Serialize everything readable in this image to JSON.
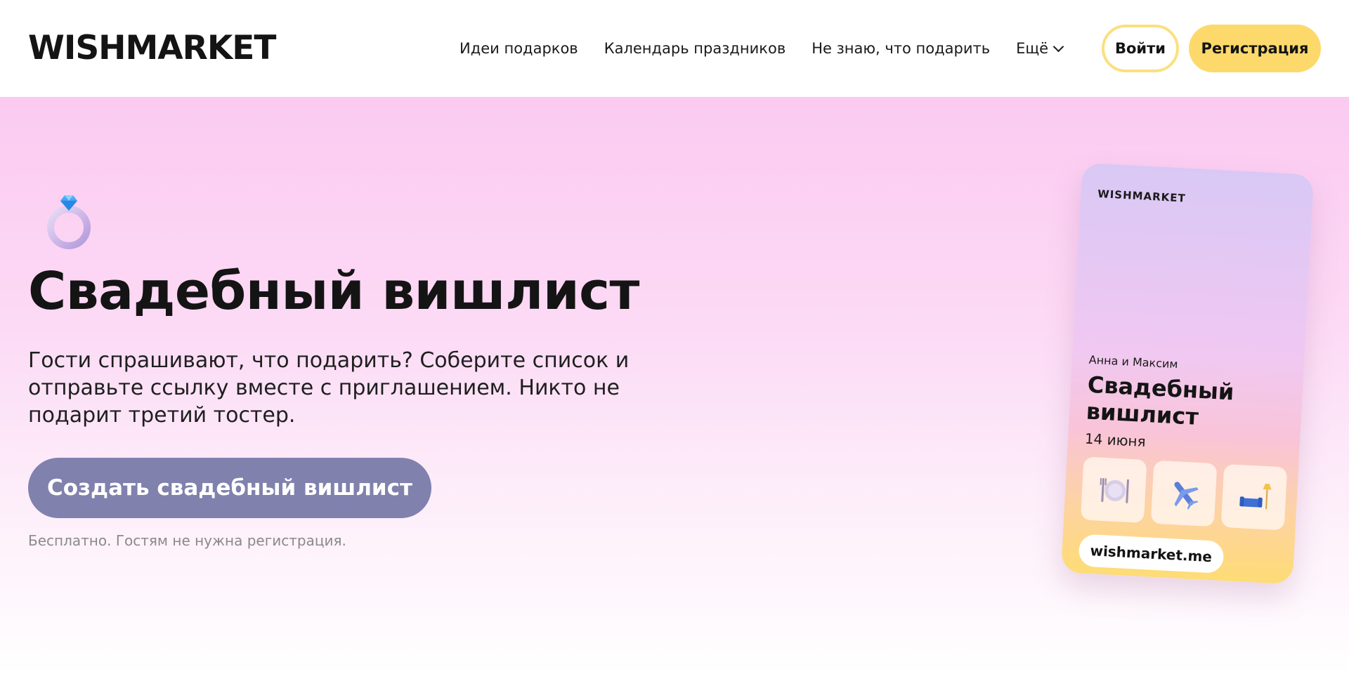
{
  "header": {
    "logo": "WISHMARKET",
    "nav": [
      {
        "label": "Идеи подарков"
      },
      {
        "label": "Календарь праздников"
      },
      {
        "label": "Не знаю, что подарить"
      },
      {
        "label": "Ещё"
      }
    ],
    "login_label": "Войти",
    "register_label": "Регистрация"
  },
  "hero": {
    "icon": "ring-icon",
    "title": "Свадебный вишлист",
    "subtitle_lines": [
      "Гости спрашивают, что подарить? Соберите список и",
      "отправьте ссылку вместе с приглашением. Никто не",
      "подарит третий тостер."
    ],
    "cta_label": "Создать свадебный вишлист",
    "note": "Бесплатно. Гостям не нужна регистрация."
  },
  "card": {
    "logo": "WISHMARKET",
    "names": "Анна и Максим",
    "title_lines": [
      "Свадебный",
      "вишлист"
    ],
    "date": "14 июня",
    "tiles": [
      {
        "icon": "plate-cutlery-icon"
      },
      {
        "icon": "airplane-icon"
      },
      {
        "icon": "sofa-lamp-icon"
      }
    ],
    "url": "wishmarket.me"
  },
  "colors": {
    "accent_yellow": "#fdd96b",
    "cta_purple": "#8081ad",
    "hero_pink": "#fbcaf1"
  }
}
